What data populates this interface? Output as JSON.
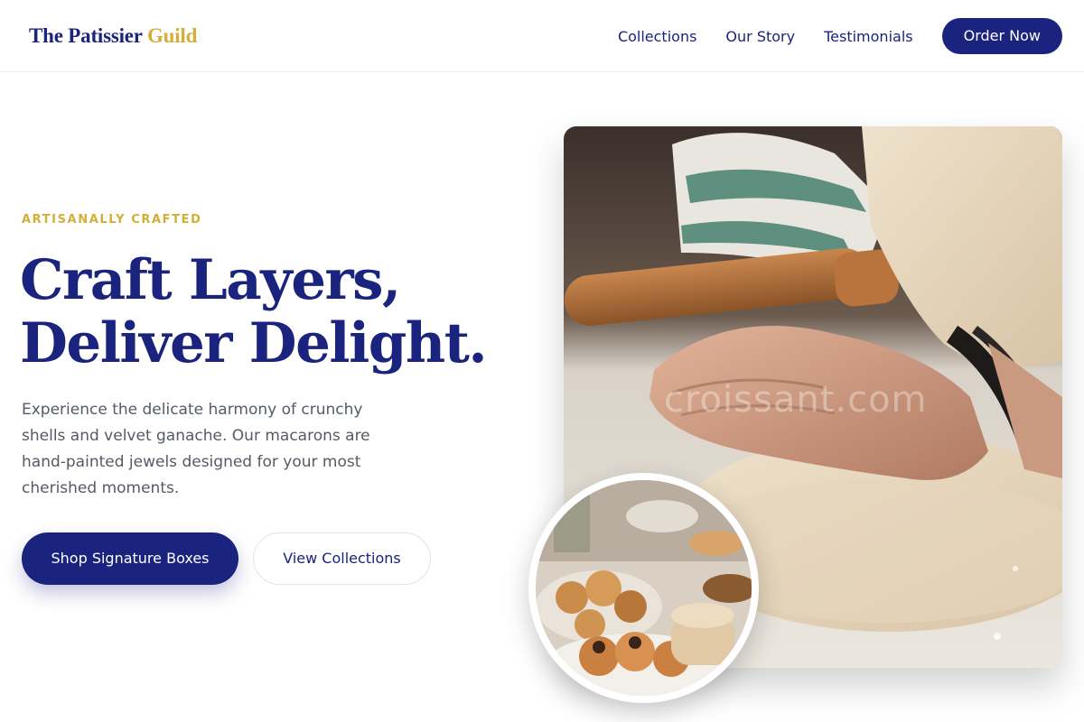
{
  "brand": {
    "name_main": "The Patissier ",
    "name_accent": "Guild",
    "colors": {
      "primary": "#1a237e",
      "accent": "#d4af37",
      "text_muted": "#555b66"
    }
  },
  "nav": {
    "items": [
      {
        "label": "Collections"
      },
      {
        "label": "Our Story"
      },
      {
        "label": "Testimonials"
      }
    ],
    "cta_label": "Order Now"
  },
  "hero": {
    "eyebrow": "ARTISANALLY CRAFTED",
    "headline_line1": "Craft Layers,",
    "headline_line2": "Deliver Delight.",
    "description": "Experience the delicate harmony of crunchy shells and velvet ganache. Our macarons are hand-painted jewels designed for your most cherished moments.",
    "primary_button": "Shop Signature Boxes",
    "secondary_button": "View Collections",
    "main_image_watermark": "croissant.com"
  }
}
